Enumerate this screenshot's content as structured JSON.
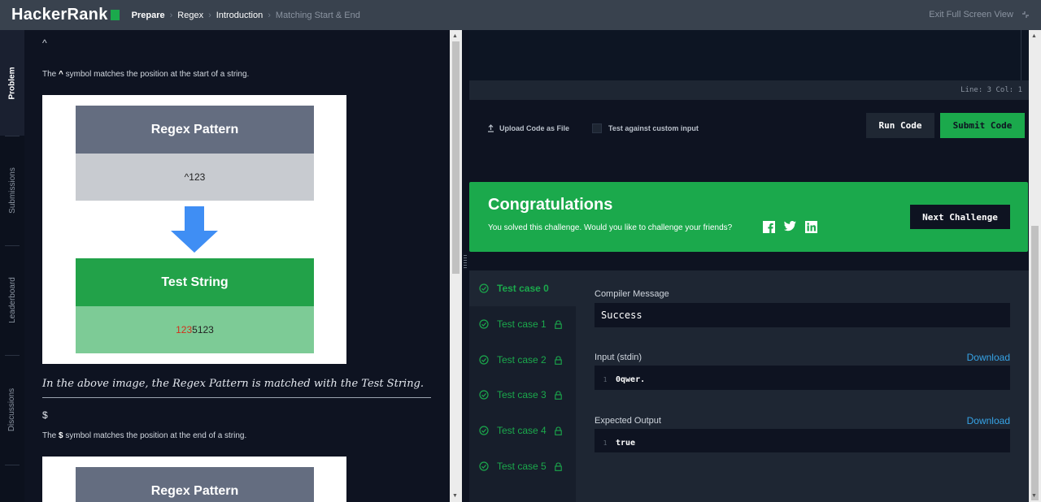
{
  "topbar": {
    "logo": "HackerRank",
    "breadcrumbs": [
      "Prepare",
      "Regex",
      "Introduction",
      "Matching Start & End"
    ],
    "exit_fullscreen": "Exit Full Screen View"
  },
  "left_tabs": [
    "Problem",
    "Submissions",
    "Leaderboard",
    "Discussions"
  ],
  "problem": {
    "caret_symbol": "^",
    "caret_desc_before": "The",
    "caret_desc_symbol": "^",
    "caret_desc_after": "symbol matches the position at the start of a string.",
    "figure1": {
      "pattern_header": "Regex Pattern",
      "pattern_value": "^123",
      "test_header": "Test String",
      "test_value_match": "123",
      "test_value_rest": "5123"
    },
    "math_line": "In the above image, the Regex Pattern is matched with the Test String.",
    "dollar_symbol": "$",
    "dollar_desc_before": "The",
    "dollar_desc_symbol": "$",
    "dollar_desc_after": "symbol matches the position at the end of a string.",
    "figure2": {
      "pattern_header": "Regex Pattern"
    }
  },
  "editor": {
    "status": "Line: 3 Col: 1"
  },
  "actions": {
    "upload_label": "Upload Code as File",
    "custom_input_label": "Test against custom input",
    "run_label": "Run Code",
    "submit_label": "Submit Code"
  },
  "congrats": {
    "title": "Congratulations",
    "message": "You solved this challenge. Would you like to challenge your friends?",
    "next_label": "Next Challenge"
  },
  "test_cases": [
    "Test case 0",
    "Test case 1",
    "Test case 2",
    "Test case 3",
    "Test case 4",
    "Test case 5"
  ],
  "result": {
    "compiler_label": "Compiler Message",
    "compiler_value": "Success",
    "input_label": "Input (stdin)",
    "input_line_no": "1",
    "input_value": "0qwer.",
    "expected_label": "Expected Output",
    "expected_line_no": "1",
    "expected_value": "true",
    "download_label": "Download"
  },
  "colors": {
    "brand_green": "#1ba94c",
    "topbar": "#39424e",
    "background": "#0e1321",
    "link_blue": "#36a3e6",
    "figure_header": "#646d80",
    "figure_green_light": "#7dcb96"
  }
}
